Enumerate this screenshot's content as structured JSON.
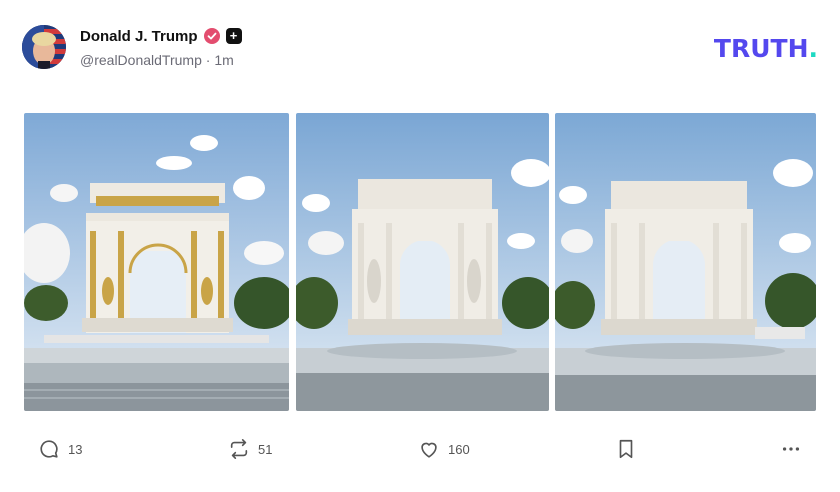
{
  "author": {
    "display_name": "Donald J. Trump",
    "handle": "@realDonaldTrump",
    "separator": " · ",
    "time": "1m",
    "verified_color": "#e34d6f"
  },
  "brand": {
    "wordmark": "TRUTH",
    "dot": ".",
    "color": "#5448ee",
    "dot_color": "#1ed9c2"
  },
  "media": [
    {
      "name": "gold-arch-image"
    },
    {
      "name": "statue-arch-image"
    },
    {
      "name": "plain-arch-image"
    }
  ],
  "actions": {
    "reply": {
      "icon": "reply-icon",
      "count": "13"
    },
    "retruth": {
      "icon": "retruth-icon",
      "count": "51"
    },
    "like": {
      "icon": "heart-icon",
      "count": "160"
    },
    "bookmark": {
      "icon": "bookmark-icon"
    },
    "more": {
      "icon": "more-icon"
    }
  }
}
